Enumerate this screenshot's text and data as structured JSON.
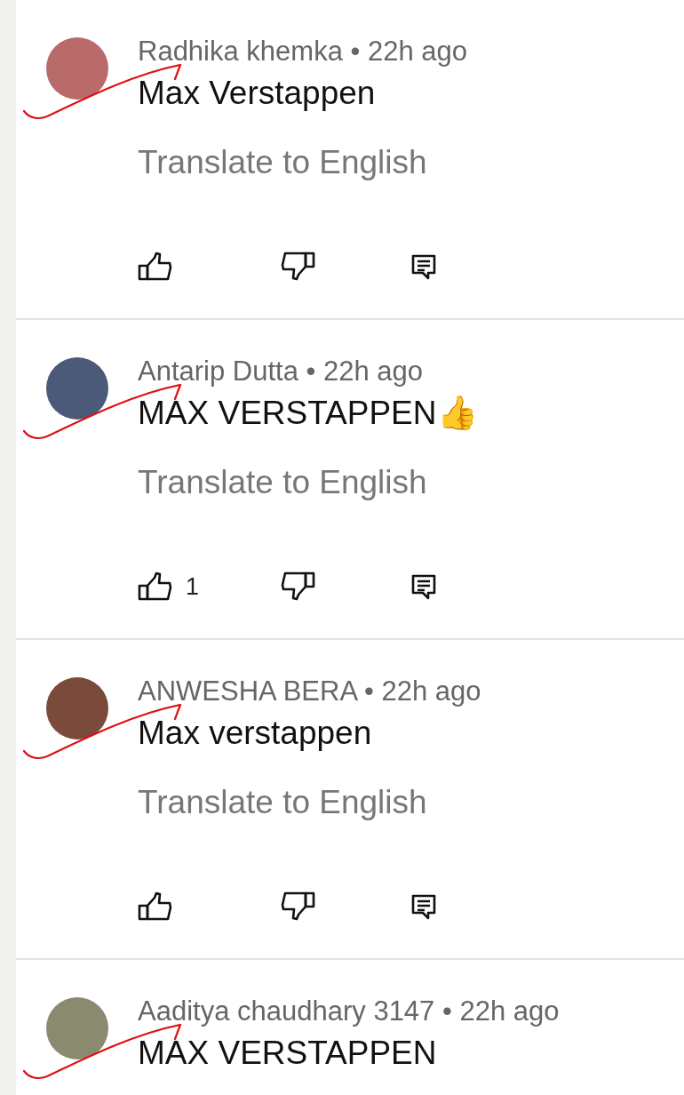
{
  "comments": [
    {
      "author": "Radhika khemka",
      "separator": "•",
      "time": "22h ago",
      "text": "Max Verstappen",
      "translate": "Translate to English"
    },
    {
      "author": "Antarip Dutta",
      "separator": "•",
      "time": "22h ago",
      "text": "MAX VERSTAPPEN👍",
      "translate": "Translate to English",
      "likes": "1"
    },
    {
      "author": "ANWESHA BERA",
      "separator": "•",
      "time": "22h ago",
      "text": "Max verstappen",
      "translate": "Translate to English"
    },
    {
      "author": "Aaditya chaudhary 3147",
      "separator": "•",
      "time": "22h ago",
      "text": "MAX VERSTAPPEN"
    }
  ]
}
